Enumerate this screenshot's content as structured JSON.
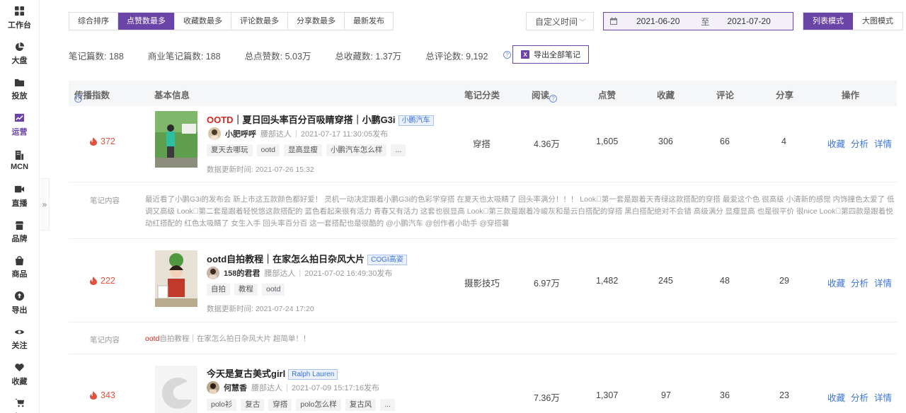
{
  "sidebar": {
    "items": [
      {
        "label": "工作台",
        "icon": "grid-icon"
      },
      {
        "label": "大盘",
        "icon": "pie-icon"
      },
      {
        "label": "投放",
        "icon": "folder-icon"
      },
      {
        "label": "运营",
        "icon": "trend-icon",
        "active": true
      },
      {
        "label": "MCN",
        "icon": "building-icon"
      },
      {
        "label": "直播",
        "icon": "video-icon"
      },
      {
        "label": "品牌",
        "icon": "shop-icon"
      },
      {
        "label": "商品",
        "icon": "bag-icon"
      },
      {
        "label": "导出",
        "icon": "upload-icon"
      },
      {
        "label": "关注",
        "icon": "eye-icon"
      },
      {
        "label": "收藏",
        "icon": "heart-icon"
      },
      {
        "label": "购买",
        "icon": "cart-icon"
      }
    ],
    "collapse_glyph": "»"
  },
  "toolbar": {
    "sort_tabs": [
      "综合排序",
      "点赞数最多",
      "收藏数最多",
      "评论数最多",
      "分享数最多",
      "最新发布"
    ],
    "active_sort": 1,
    "time_select": "自定义时间",
    "date_start": "2021-06-20",
    "date_to": "至",
    "date_end": "2021-07-20",
    "view_modes": [
      "列表模式",
      "大图模式"
    ],
    "active_view": 0
  },
  "stats": {
    "notes": "笔记篇数: 188",
    "business_notes": "商业笔记篇数: 188",
    "likes": "总点赞数: 5.03万",
    "collects": "总收藏数: 1.37万",
    "comments": "总评论数: 9,192",
    "export_label": "导出全部笔记"
  },
  "table": {
    "headers": {
      "index": "传播指数",
      "info": "基本信息",
      "category": "笔记分类",
      "reads": "阅读",
      "likes": "点赞",
      "collects": "收藏",
      "comments": "评论",
      "shares": "分享",
      "ops": "操作"
    },
    "content_label": "笔记内容",
    "ops": {
      "collect": "收藏",
      "analyze": "分析",
      "detail": "详情"
    },
    "rows": [
      {
        "heat": "372",
        "title_kw": "OOTD",
        "title": "｜夏日回头率百分百吸睛穿搭｜小鹏G3i",
        "brand": "小鹏汽车",
        "author": "小肥呼呼",
        "level": "腰部达人",
        "published": "2021-07-17 11:30:05发布",
        "tags": [
          "夏天去哪玩",
          "ootd",
          "显高显瘦",
          "小鹏汽车怎么样",
          "..."
        ],
        "updated": "数据更新时间: 2021-07-26 15:32",
        "category": "穿搭",
        "reads": "4.36万",
        "likes": "1,605",
        "collects": "306",
        "comments": "66",
        "shares": "4",
        "content": "最近看了小鹏G3i的发布会 新上市这五款颜色都好爱！ 灵机一动决定跟着小鹏G3i的色彩学穿搭 在夏天也太吸睛了 回头率满分！！！ Look⃣第一套是跟着天青绿这款搭配的穿搭 最爱这个色 很高级 小清新的感觉 内饰撞色太爱了 低调又高级 Look⃣第二套是跟着轻悦悠这款搭配的 蓝色看起来很有活力 青春又有活力 这套也很显高 Look⃣第三款是跟着冷峻灰和是云白搭配的穿搭 黑白搭配绝对不会错 高级满分 显瘦显高 也是很平价 很nice Look⃣第四款是跟着悦动红搭配的 红色太吸睛了 女生入手 回头率百分百 这一套搭配也是很酷的 @小鹏汽车 @创作者小助手 @穿搭薯"
      },
      {
        "heat": "222",
        "title_kw": "",
        "title": "ootd自拍教程｜在家怎么拍日杂风大片",
        "brand": "COGI高姿",
        "author": "158的君君",
        "level": "腰部达人",
        "published": "2021-07-02 16:49:30发布",
        "tags": [
          "自拍",
          "教程",
          "ootd"
        ],
        "updated": "数据更新时间: 2021-07-24 17:20",
        "category": "摄影技巧",
        "reads": "6.97万",
        "likes": "1,482",
        "collects": "245",
        "comments": "48",
        "shares": "29",
        "content_kw": "ootd",
        "content": "自拍教程｜在家怎么拍日杂风大片 超简单！！"
      },
      {
        "heat": "343",
        "title_kw": "",
        "title": "今天是复古美式girl",
        "brand": "Ralph Lauren",
        "author": "何慧香",
        "level": "腰部达人",
        "published": "2021-07-09 15:17:16发布",
        "tags": [
          "polo衫",
          "复古",
          "穿搭",
          "polo怎么样",
          "复古风",
          "..."
        ],
        "category": "",
        "reads": "7.36万",
        "likes": "1,307",
        "collects": "97",
        "comments": "36",
        "shares": "23"
      }
    ]
  },
  "colors": {
    "accent": "#6b44a8",
    "link": "#3b74d6",
    "heat": "#e0523f"
  }
}
